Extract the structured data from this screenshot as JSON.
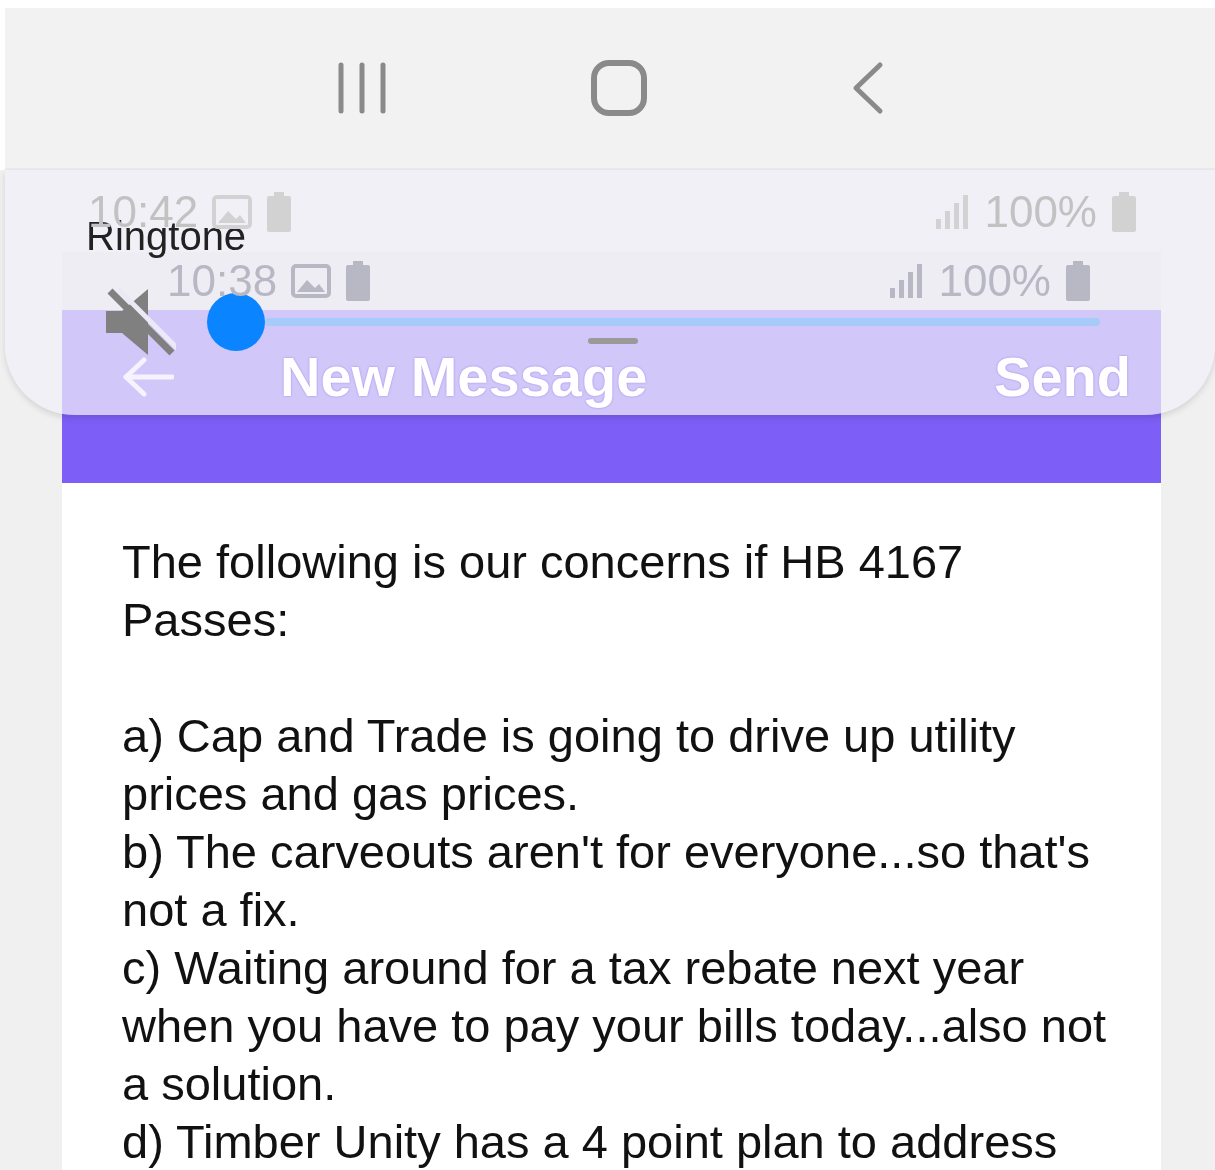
{
  "status_bars": [
    {
      "time": "10:42",
      "battery": "100%"
    },
    {
      "time": "10:38",
      "battery": "100%"
    }
  ],
  "app_bar": {
    "title": "New Message",
    "action": "Send"
  },
  "volume_panel": {
    "label": "Ringtone",
    "muted": true,
    "level": 0
  },
  "message": {
    "paragraphs": [
      "The following is our concerns if HB 4167 Passes:",
      "a) Cap and Trade is going to drive up utility prices and gas prices.",
      "b) The carveouts aren't for everyone...so that's not a fix.",
      "c) Waiting around for a tax rebate next year when you have to pay your bills today...also not a solution.",
      "d) Timber Unity has a 4 point plan to address"
    ]
  }
}
